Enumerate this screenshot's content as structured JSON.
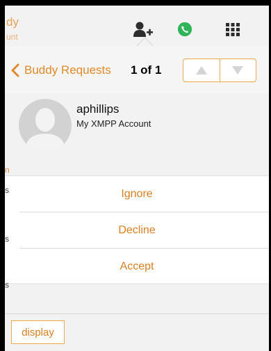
{
  "background_app": {
    "title_fragment": "dy",
    "subtitle_fragment": "unt",
    "side_fragments": [
      "n",
      "s",
      "s",
      "s"
    ],
    "icons": [
      "add-buddy-icon",
      "call-icon",
      "grid-icon"
    ]
  },
  "popover": {
    "nav": {
      "back_label": "Buddy Requests",
      "count": "1 of 1",
      "stepper_icons": [
        "up-arrow-icon",
        "down-arrow-icon"
      ]
    },
    "contact": {
      "name": "aphillips",
      "account": "My XMPP Account",
      "avatar_icon": "default-avatar-icon"
    },
    "actions": [
      "Ignore",
      "Decline",
      "Accept"
    ],
    "display_button": "display"
  },
  "colors": {
    "accent": "#e08a2a",
    "accent_border": "#f0a850",
    "call_green": "#2fb45a"
  }
}
